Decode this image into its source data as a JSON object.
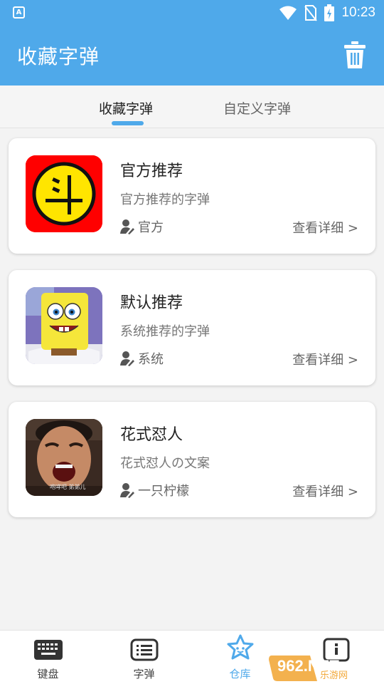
{
  "status_bar": {
    "time": "10:23",
    "notification_icon": "a-icon"
  },
  "app_bar": {
    "title": "收藏字弹",
    "action_icon": "trash-icon"
  },
  "tabs": [
    {
      "label": "收藏字弹",
      "active": true
    },
    {
      "label": "自定义字弹",
      "active": false
    }
  ],
  "cards": [
    {
      "title": "官方推荐",
      "description": "官方推荐的字弹",
      "author": "官方",
      "detail_link": "查看详细 >",
      "thumbnail": "dou-logo"
    },
    {
      "title": "默认推荐",
      "description": "系统推荐的字弹",
      "author": "系统",
      "detail_link": "查看详细 >",
      "thumbnail": "spongebob-image"
    },
    {
      "title": "花式怼人",
      "description": "花式怼人の文案",
      "author": "一只柠檬",
      "detail_link": "查看详细 >",
      "thumbnail": "shouting-man-image",
      "thumbnail_caption": "咆哮吧 弟弟儿"
    }
  ],
  "bottom_nav": [
    {
      "label": "键盘",
      "icon": "keyboard-icon",
      "active": false
    },
    {
      "label": "字弹",
      "icon": "text-list-icon",
      "active": false
    },
    {
      "label": "仓库",
      "icon": "star-icon",
      "active": true
    },
    {
      "label": "",
      "icon": "profile-icon",
      "active": false
    }
  ],
  "watermark": {
    "text": "962.NET",
    "subtext": "乐游网"
  },
  "colors": {
    "accent": "#4fa9ea",
    "dou_red": "#ff0000",
    "dou_yellow": "#ffe500"
  }
}
